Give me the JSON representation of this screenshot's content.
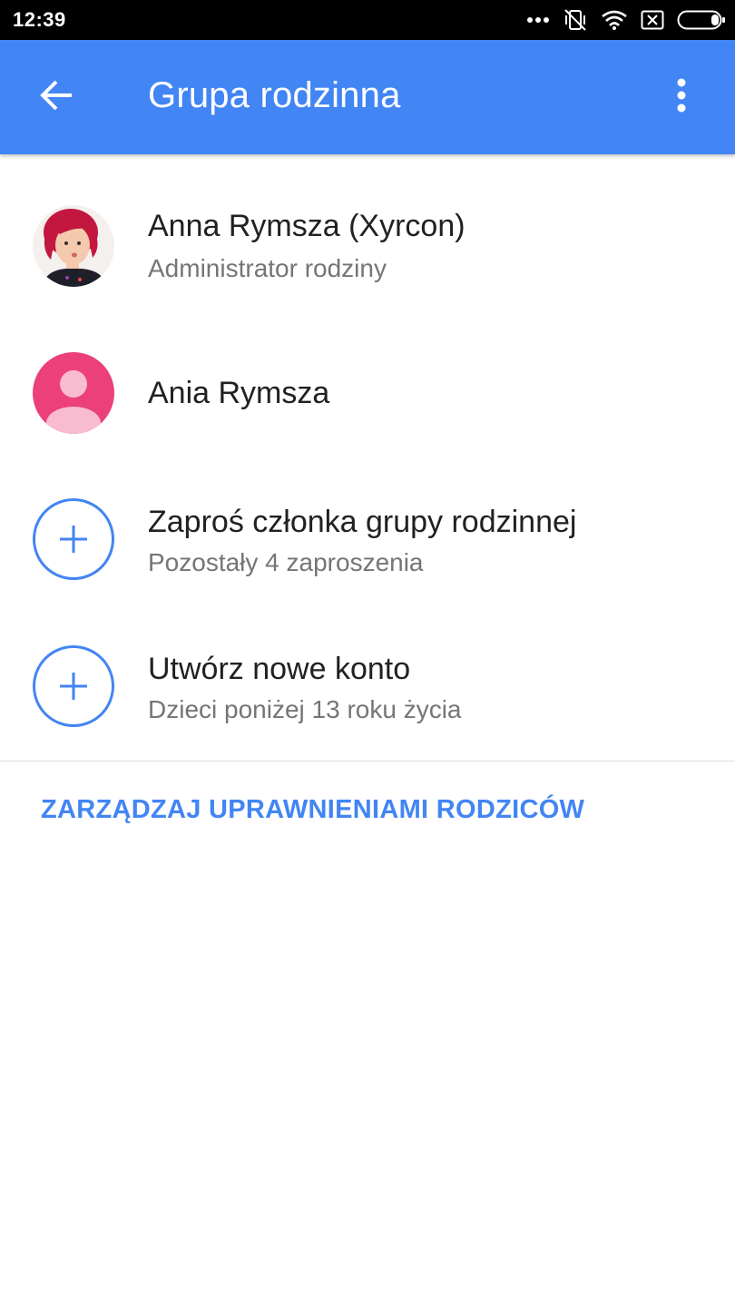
{
  "status_bar": {
    "time": "12:39",
    "icons": [
      "more-dots-icon",
      "vibrate-off-icon",
      "wifi-icon",
      "sim-error-icon",
      "battery-icon"
    ]
  },
  "app_bar": {
    "back_icon": "arrow-back-icon",
    "title": "Grupa rodzinna",
    "menu_icon": "more-vert-icon",
    "color": "#4285f4"
  },
  "members": [
    {
      "name": "Anna Rymsza (Xyrcon)",
      "role": "Administrator rodziny",
      "avatar": "photo-avatar"
    },
    {
      "name": "Ania Rymsza",
      "role": "",
      "avatar": "default-person-avatar",
      "avatar_color": "#ec407a"
    }
  ],
  "actions": [
    {
      "title": "Zaproś członka grupy rodzinnej",
      "subtitle": "Pozostały 4 zaproszenia",
      "icon": "add-circle-icon"
    },
    {
      "title": "Utwórz nowe konto",
      "subtitle": "Dzieci poniżej 13 roku życia",
      "icon": "add-circle-icon"
    }
  ],
  "manage_link": "ZARZĄDZAJ UPRAWNIENIAMI RODZICÓW",
  "colors": {
    "accent": "#4285f4",
    "primary_text": "#212121",
    "secondary_text": "#757575"
  }
}
